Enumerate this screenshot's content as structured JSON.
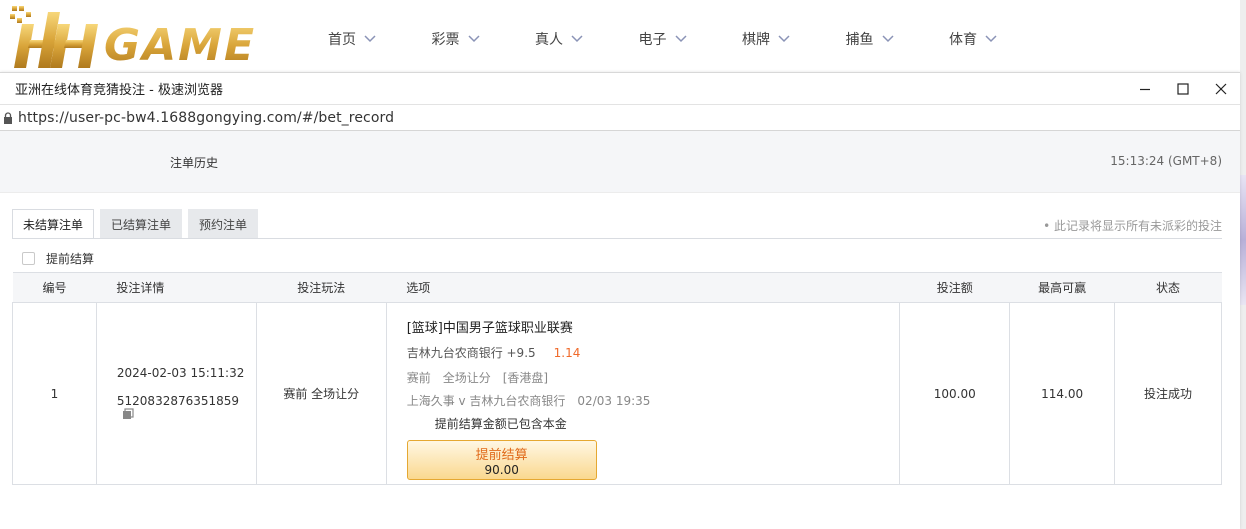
{
  "site": {
    "nav": [
      "首页",
      "彩票",
      "真人",
      "电子",
      "棋牌",
      "捕鱼",
      "体育"
    ]
  },
  "window": {
    "title": "亚洲在线体育竞猜投注 - 极速浏览器",
    "url": "https://user-pc-bw4.1688gongying.com/#/bet_record"
  },
  "page": {
    "title": "注单历史",
    "time": "15:13:24 (GMT+8)",
    "tabs": [
      "未结算注单",
      "已结算注单",
      "预约注单"
    ],
    "note": "• 此记录将显示所有未派彩的投注",
    "early_label": "提前结算"
  },
  "table": {
    "headers": [
      "编号",
      "投注详情",
      "投注玩法",
      "选项",
      "投注额",
      "最高可赢",
      "状态"
    ],
    "rows": [
      {
        "no": "1",
        "time": "2024-02-03 15:11:32",
        "order_id": "5120832876351859",
        "play": "赛前 全场让分",
        "league": "[篮球]中国男子篮球职业联赛",
        "pick": "吉林九台农商银行 +9.5",
        "odds": "1.14",
        "period": "赛前",
        "market": "全场让分",
        "handicap": "[香港盘]",
        "match": "上海久事 v 吉林九台农商银行",
        "match_time": "02/03 19:35",
        "cashout_note": "提前结算金额已包含本金",
        "cashout_label": "提前结算",
        "cashout_value": "90.00",
        "stake": "100.00",
        "max_win": "114.00",
        "status": "投注成功"
      }
    ]
  }
}
